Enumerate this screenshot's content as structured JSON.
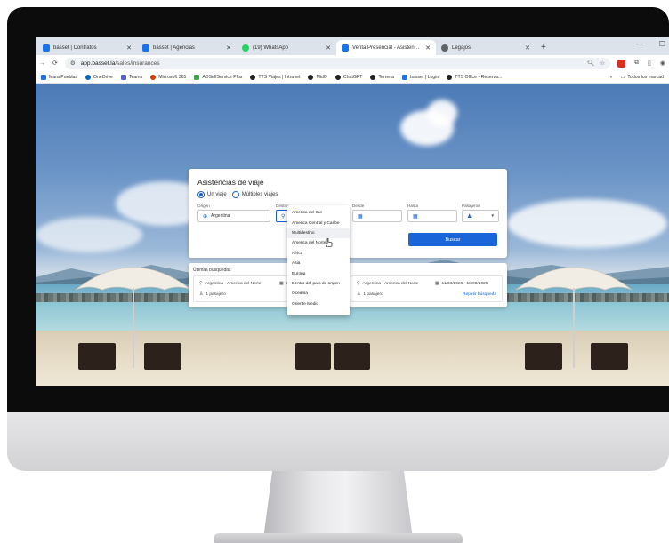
{
  "browser": {
    "tabs": [
      {
        "title": "basset | Contratos",
        "favicon_color": "#1a73e8",
        "active": false
      },
      {
        "title": "basset | Agencias",
        "favicon_color": "#1a73e8",
        "active": false
      },
      {
        "title": "(19) WhatsApp",
        "favicon_color": "#25d366",
        "active": false
      },
      {
        "title": "Venta Presencial - Asistencias d",
        "favicon_color": "#1a73e8",
        "active": true
      },
      {
        "title": "Legajos",
        "favicon_color": "#5f6368",
        "active": false
      }
    ],
    "new_tab": "+",
    "url_host": "app.basset.la",
    "url_path": "/sales/insurances",
    "bookmarks": [
      {
        "label": "Mara Pueblas",
        "color": "#1a73e8"
      },
      {
        "label": "OneDrive",
        "color": "#0a66c2"
      },
      {
        "label": "Teams",
        "color": "#5b5fc7"
      },
      {
        "label": "Microsoft 365",
        "color": "#d83b01"
      },
      {
        "label": "ADSelfService Plus",
        "color": "#3aa845"
      },
      {
        "label": "TTS Viajes | Intranet",
        "color": "#202124"
      },
      {
        "label": "MidO",
        "color": "#202124"
      },
      {
        "label": "ChatGPT",
        "color": "#202124"
      },
      {
        "label": "Terrena",
        "color": "#202124"
      },
      {
        "label": "basset | Login",
        "color": "#1a73e8"
      },
      {
        "label": "TTS Office - Reserva...",
        "color": "#202124"
      }
    ],
    "bookmarks_more": "»",
    "all_bookmarks": "Todos los marcad"
  },
  "form": {
    "title": "Asistencias de viaje",
    "trip_options": [
      "Un viaje",
      "Múltiples viajes"
    ],
    "selected_trip": 0,
    "labels": {
      "origin": "Origen",
      "destination": "Destino",
      "from": "Desde",
      "to": "Hasta",
      "passengers": "Pasajeros"
    },
    "origin_value": "Argentina",
    "search_button": "Buscar"
  },
  "destination_dropdown": {
    "options": [
      "America del Sur",
      "America Central y Caribe",
      "Multidestino",
      "America del Norte",
      "Africa",
      "Asia",
      "Europa",
      "Dentro del país de origen",
      "Oceania",
      "Oriente Medio"
    ],
    "hovered_index": 2
  },
  "recent": {
    "title": "Últimas búsquedas",
    "items": [
      {
        "route": "Argentina - America del Norte",
        "dates": "1(",
        "passengers": "1 pasajero"
      },
      {
        "route": "Argentina - America del Norte",
        "dates": "11/03/2026 - 18/03/2026",
        "passengers": "1 pasajero",
        "action": "Repetir búsqueda"
      }
    ]
  },
  "colors": {
    "primary": "#1a66d8",
    "radio": "#1a5fd0"
  }
}
